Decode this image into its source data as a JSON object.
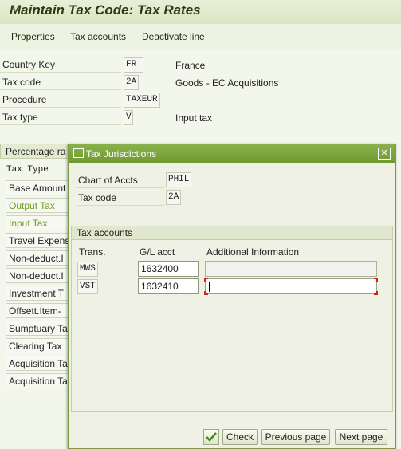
{
  "window": {
    "title": "Maintain Tax Code: Tax Rates"
  },
  "toolbar": {
    "properties": "Properties",
    "tax_accounts": "Tax accounts",
    "deactivate_line": "Deactivate line"
  },
  "form": {
    "country_key": {
      "label": "Country Key",
      "value": "FR",
      "description": "France"
    },
    "tax_code": {
      "label": "Tax code",
      "value": "2A",
      "description": "Goods - EC Acquisitions"
    },
    "procedure": {
      "label": "Procedure",
      "value": "TAXEUR"
    },
    "tax_type": {
      "label": "Tax type",
      "value": "V",
      "description": "Input tax"
    }
  },
  "percentage_tab": {
    "label": "Percentage ra"
  },
  "tax_type_list": {
    "header": "Tax Type",
    "rows": [
      "Base Amount",
      "Output Tax",
      "Input Tax",
      "Travel Expense",
      "Non-deduct.I",
      "Non-deduct.I",
      "Investment T",
      "Offsett.Item-",
      "Sumptuary Ta",
      "Clearing Tax",
      "Acquisition Ta",
      "Acquisition Ta"
    ]
  },
  "dialog": {
    "title": "Tax Jurisdictions",
    "chart_of_accts": {
      "label": "Chart of Accts",
      "value": "PHIL"
    },
    "tax_code": {
      "label": "Tax code",
      "value": "2A"
    },
    "group_title": "Tax accounts",
    "columns": {
      "trans": "Trans.",
      "gl_acct": "G/L acct",
      "additional_info": "Additional Information"
    },
    "rows": [
      {
        "trans": "MWS",
        "gl_acct": "1632400",
        "info": ""
      },
      {
        "trans": "VST",
        "gl_acct": "1632410",
        "info": ""
      }
    ],
    "buttons": {
      "check": "Check",
      "previous_page": "Previous page",
      "next_page": "Next page"
    }
  },
  "colors": {
    "dialog_title": "#7da53d",
    "green_text": "#6a9d1e",
    "focus_marker": "#d02020"
  }
}
